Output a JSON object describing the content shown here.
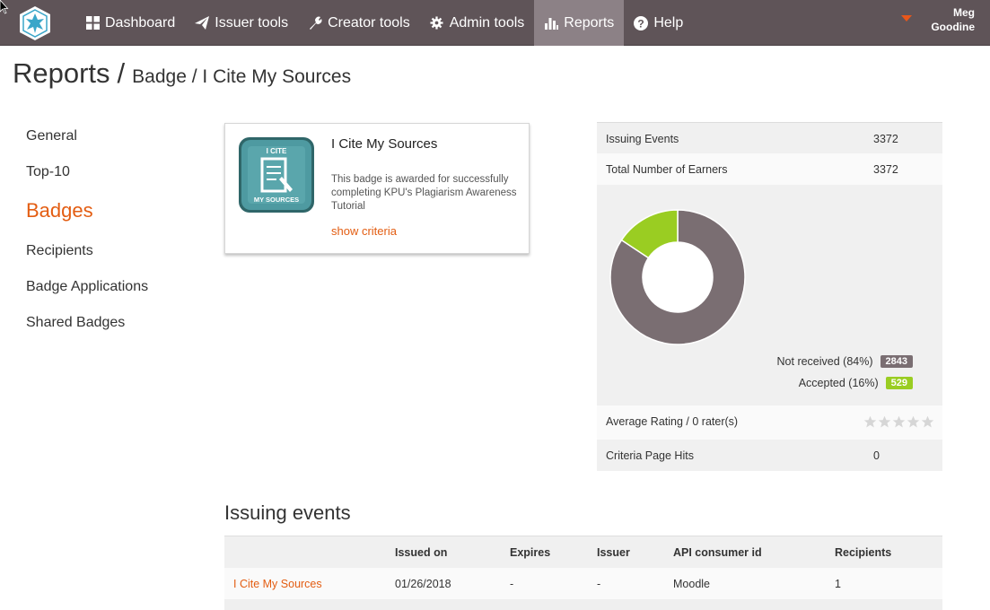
{
  "nav": {
    "items": [
      {
        "label": "Dashboard",
        "icon": "dashboard-icon"
      },
      {
        "label": "Issuer tools",
        "icon": "paper-plane-icon"
      },
      {
        "label": "Creator tools",
        "icon": "wrench-icon"
      },
      {
        "label": "Admin tools",
        "icon": "gear-icon"
      },
      {
        "label": "Reports",
        "icon": "bar-chart-icon",
        "active": true
      },
      {
        "label": "Help",
        "icon": "help-icon"
      }
    ],
    "user_first": "Meg",
    "user_last": "Goodine"
  },
  "breadcrumb": {
    "main": "Reports",
    "separator": "/",
    "sub": "Badge / I Cite My Sources"
  },
  "sidebar": {
    "items": [
      {
        "label": "General"
      },
      {
        "label": "Top-10"
      },
      {
        "label": "Badges",
        "active": true
      },
      {
        "label": "Recipients"
      },
      {
        "label": "Badge Applications"
      },
      {
        "label": "Shared Badges"
      }
    ]
  },
  "badge_card": {
    "title": "I Cite My Sources",
    "description": "This badge is awarded for successfully completing KPU's Plagiarism Awareness Tutorial",
    "link": "show criteria",
    "image_text_top": "I CITE",
    "image_text_bottom": "MY SOURCES"
  },
  "stats": {
    "issuing_events_label": "Issuing Events",
    "issuing_events_value": "3372",
    "total_earners_label": "Total Number of Earners",
    "total_earners_value": "3372",
    "rating_label": "Average Rating / 0 rater(s)",
    "rating_stars": 0,
    "criteria_hits_label": "Criteria Page Hits",
    "criteria_hits_value": "0"
  },
  "chart_data": {
    "type": "pie",
    "title": "",
    "categories": [
      "Not received (84%)",
      "Accepted (16%)"
    ],
    "values": [
      2843,
      529
    ],
    "colors": [
      "#7a6e72",
      "#9acd22"
    ],
    "donut": true
  },
  "events": {
    "title": "Issuing events",
    "columns": [
      "",
      "Issued on",
      "Expires",
      "Issuer",
      "API consumer id",
      "Recipients"
    ],
    "rows": [
      {
        "name": "I Cite My Sources",
        "issued_on": "01/26/2018",
        "expires": "-",
        "issuer": "-",
        "api": "Moodle",
        "recipients": "1"
      }
    ]
  }
}
